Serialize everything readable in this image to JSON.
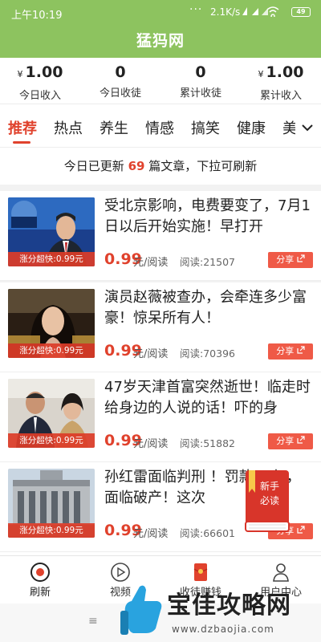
{
  "status_bar": {
    "time": "上午10:19",
    "dots": "···",
    "speed": "2.1K/s",
    "battery": "49"
  },
  "app": {
    "title": "猛犸网"
  },
  "stats": [
    {
      "currency": "¥",
      "value": "1.00",
      "label": "今日收入"
    },
    {
      "currency": "",
      "value": "0",
      "label": "今日收徒"
    },
    {
      "currency": "",
      "value": "0",
      "label": "累计收徒"
    },
    {
      "currency": "¥",
      "value": "1.00",
      "label": "累计收入"
    }
  ],
  "tabs": [
    "推荐",
    "热点",
    "养生",
    "情感",
    "搞笑",
    "健康",
    "美"
  ],
  "tab_more_icon": "chevron-down-icon",
  "notice": {
    "before": "今日已更新",
    "count": "69",
    "after": "篇文章，下拉可刷新"
  },
  "articles": [
    {
      "title": "受北京影响，电费要变了，7月1日以后开始实施！早打开",
      "tag": "涨分超快:0.99元",
      "price": "0.99",
      "unit": "元/阅读",
      "reads": "阅读:21507",
      "share": "分享"
    },
    {
      "title": "演员赵薇被查办，会牵连多少富豪！惊呆所有人！",
      "tag": "涨分超快:0.99元",
      "price": "0.99",
      "unit": "元/阅读",
      "reads": "阅读:70396",
      "share": "分享"
    },
    {
      "title": "47岁天津首富突然逝世！临走时给身边的人说的话！吓的身",
      "tag": "涨分超快:0.99元",
      "price": "0.99",
      "unit": "元/阅读",
      "reads": "阅读:51882",
      "share": "分享"
    },
    {
      "title": "孙红雷面临判刑 ！罚款20亿，面临破产！这次",
      "tag": "涨分超快:0.99元",
      "price": "0.99",
      "unit": "元/阅读",
      "reads": "阅读:66601",
      "share": "分享"
    }
  ],
  "float_badge": {
    "line1": "新手",
    "line2": "必读"
  },
  "bottom_nav": [
    {
      "label": "刷新",
      "icon": "refresh-icon"
    },
    {
      "label": "视频",
      "icon": "play-icon"
    },
    {
      "label": "收徒赚钱",
      "icon": "red-envelope-icon"
    },
    {
      "label": "用户中心",
      "icon": "user-icon"
    }
  ],
  "system_bar": {
    "menu": "≡"
  },
  "watermark": {
    "main": "宝佳攻略网",
    "sub": "www.dzbaojia.com"
  },
  "colors": {
    "header": "#8dc35f",
    "accent": "#e0422d",
    "share": "#ef5a47"
  }
}
